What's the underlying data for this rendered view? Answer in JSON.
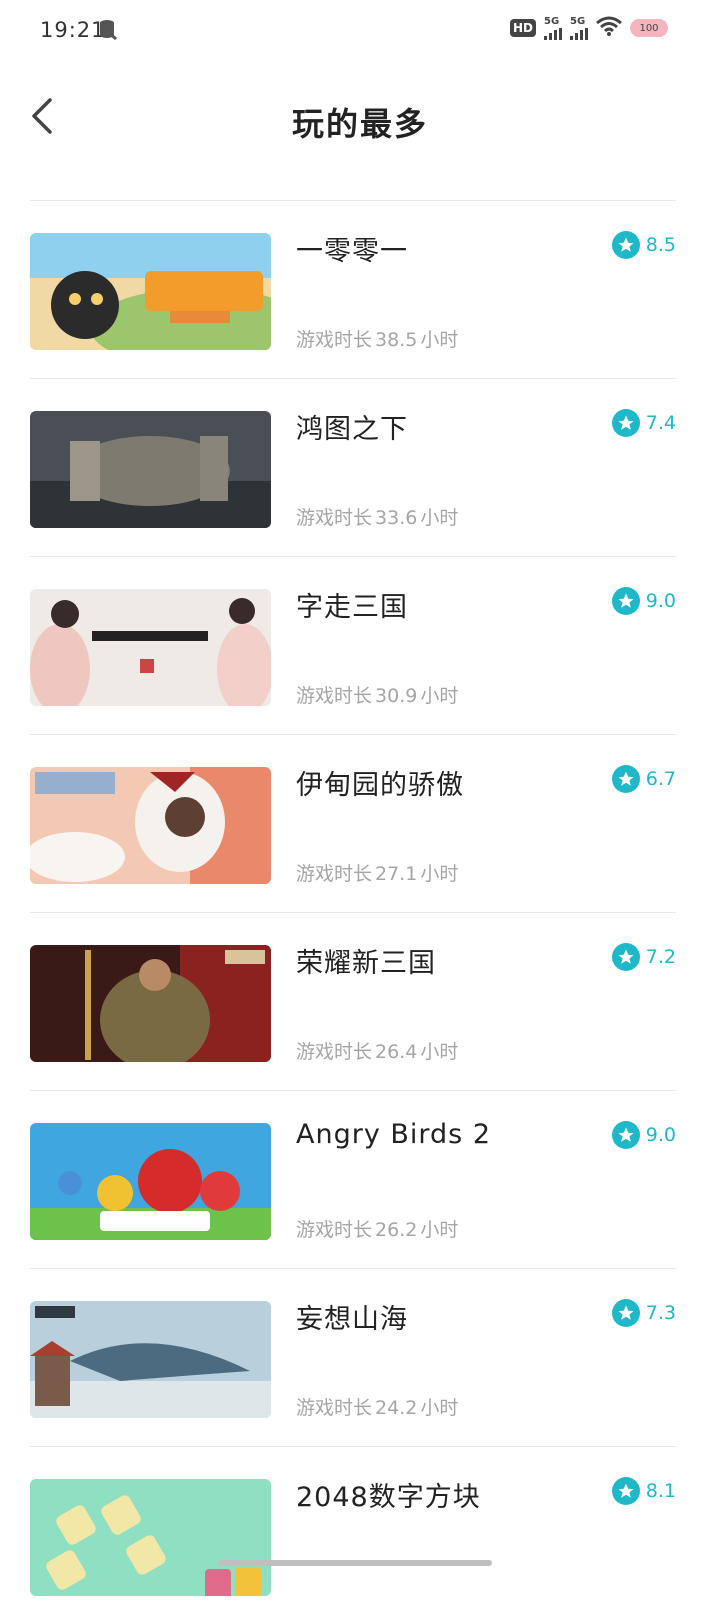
{
  "status": {
    "time": "19:21",
    "hd": "HD",
    "net1": "5G",
    "net2": "5G",
    "battery": "100"
  },
  "header": {
    "title": "玩的最多"
  },
  "labels": {
    "duration_prefix": "游戏时长",
    "duration_suffix": "小时"
  },
  "colors": {
    "accent": "#1fb8c9"
  },
  "games": [
    {
      "name": "一零零一",
      "hours": "38.5",
      "rating": "8.5"
    },
    {
      "name": "鸿图之下",
      "hours": "33.6",
      "rating": "7.4"
    },
    {
      "name": "字走三国",
      "hours": "30.9",
      "rating": "9.0"
    },
    {
      "name": "伊甸园的骄傲",
      "hours": "27.1",
      "rating": "6.7"
    },
    {
      "name": "荣耀新三国",
      "hours": "26.4",
      "rating": "7.2"
    },
    {
      "name": "Angry Birds 2",
      "hours": "26.2",
      "rating": "9.0"
    },
    {
      "name": "妄想山海",
      "hours": "24.2",
      "rating": "7.3"
    },
    {
      "name": "2048数字方块",
      "hours": "",
      "rating": "8.1"
    }
  ]
}
